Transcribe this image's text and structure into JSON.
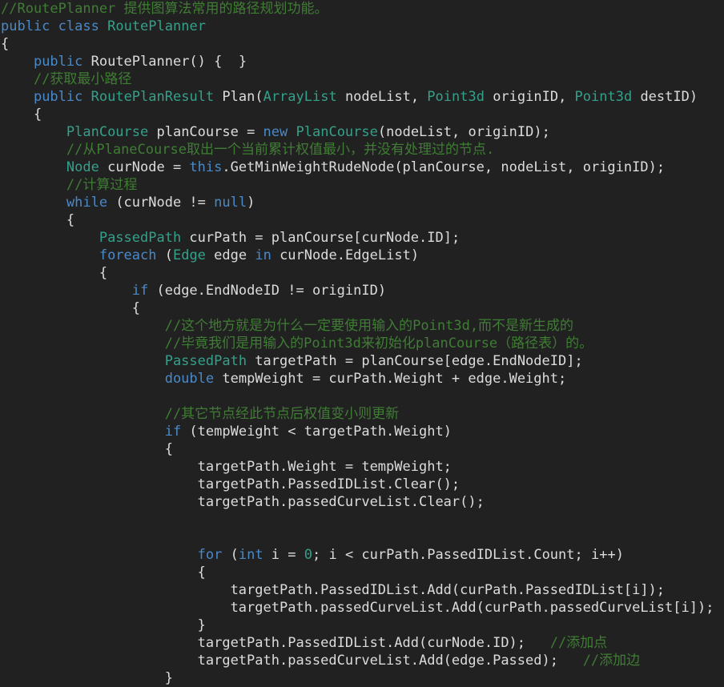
{
  "editor": {
    "language": "csharp",
    "file_title": "RoutePlanner.cs",
    "background_color": "#212121",
    "foreground_color": "#dcdcdc",
    "colors": {
      "keyword": "#4a89c8",
      "type": "#35a08a",
      "comment": "#3f7d34",
      "number": "#35a08a",
      "plain": "#dcdcdc"
    },
    "font_size_px": 17,
    "line_height_px": 22,
    "tab_size": 4
  },
  "code": {
    "lines": [
      {
        "n": 1,
        "tokens": [
          {
            "t": "comment",
            "v": "//RoutePlanner 提供图算法常用的路径规划功能。"
          }
        ]
      },
      {
        "n": 2,
        "tokens": [
          {
            "t": "kw",
            "v": "public"
          },
          {
            "t": "plain",
            "v": " "
          },
          {
            "t": "kw",
            "v": "class"
          },
          {
            "t": "plain",
            "v": " "
          },
          {
            "t": "type",
            "v": "RoutePlanner"
          }
        ]
      },
      {
        "n": 3,
        "tokens": [
          {
            "t": "plain",
            "v": "{"
          }
        ]
      },
      {
        "n": 4,
        "tokens": [
          {
            "t": "plain",
            "v": "    "
          },
          {
            "t": "kw",
            "v": "public"
          },
          {
            "t": "plain",
            "v": " RoutePlanner() {  }"
          }
        ]
      },
      {
        "n": 5,
        "tokens": [
          {
            "t": "plain",
            "v": "    "
          },
          {
            "t": "comment",
            "v": "//获取最小路径"
          }
        ]
      },
      {
        "n": 6,
        "tokens": [
          {
            "t": "plain",
            "v": "    "
          },
          {
            "t": "kw",
            "v": "public"
          },
          {
            "t": "plain",
            "v": " "
          },
          {
            "t": "type",
            "v": "RoutePlanResult"
          },
          {
            "t": "plain",
            "v": " Plan("
          },
          {
            "t": "type",
            "v": "ArrayList"
          },
          {
            "t": "plain",
            "v": " nodeList, "
          },
          {
            "t": "type",
            "v": "Point3d"
          },
          {
            "t": "plain",
            "v": " originID, "
          },
          {
            "t": "type",
            "v": "Point3d"
          },
          {
            "t": "plain",
            "v": " destID)"
          }
        ]
      },
      {
        "n": 7,
        "tokens": [
          {
            "t": "plain",
            "v": "    {"
          }
        ]
      },
      {
        "n": 8,
        "tokens": [
          {
            "t": "plain",
            "v": "        "
          },
          {
            "t": "type",
            "v": "PlanCourse"
          },
          {
            "t": "plain",
            "v": " planCourse = "
          },
          {
            "t": "kw",
            "v": "new"
          },
          {
            "t": "plain",
            "v": " "
          },
          {
            "t": "type",
            "v": "PlanCourse"
          },
          {
            "t": "plain",
            "v": "(nodeList, originID);"
          }
        ]
      },
      {
        "n": 9,
        "tokens": [
          {
            "t": "plain",
            "v": "        "
          },
          {
            "t": "comment",
            "v": "//从PlaneCourse取出一个当前累计权值最小，并没有处理过的节点."
          }
        ]
      },
      {
        "n": 10,
        "tokens": [
          {
            "t": "plain",
            "v": "        "
          },
          {
            "t": "type",
            "v": "Node"
          },
          {
            "t": "plain",
            "v": " curNode = "
          },
          {
            "t": "kw",
            "v": "this"
          },
          {
            "t": "plain",
            "v": ".GetMinWeightRudeNode(planCourse, nodeList, originID);"
          }
        ]
      },
      {
        "n": 11,
        "tokens": [
          {
            "t": "plain",
            "v": "        "
          },
          {
            "t": "comment",
            "v": "//计算过程"
          }
        ]
      },
      {
        "n": 12,
        "tokens": [
          {
            "t": "plain",
            "v": "        "
          },
          {
            "t": "kw",
            "v": "while"
          },
          {
            "t": "plain",
            "v": " (curNode != "
          },
          {
            "t": "kw",
            "v": "null"
          },
          {
            "t": "plain",
            "v": ")"
          }
        ]
      },
      {
        "n": 13,
        "tokens": [
          {
            "t": "plain",
            "v": "        {"
          }
        ]
      },
      {
        "n": 14,
        "tokens": [
          {
            "t": "plain",
            "v": "            "
          },
          {
            "t": "type",
            "v": "PassedPath"
          },
          {
            "t": "plain",
            "v": " curPath = planCourse[curNode.ID];"
          }
        ]
      },
      {
        "n": 15,
        "tokens": [
          {
            "t": "plain",
            "v": "            "
          },
          {
            "t": "kw",
            "v": "foreach"
          },
          {
            "t": "plain",
            "v": " ("
          },
          {
            "t": "type",
            "v": "Edge"
          },
          {
            "t": "plain",
            "v": " edge "
          },
          {
            "t": "kw",
            "v": "in"
          },
          {
            "t": "plain",
            "v": " curNode.EdgeList)"
          }
        ]
      },
      {
        "n": 16,
        "tokens": [
          {
            "t": "plain",
            "v": "            {"
          }
        ]
      },
      {
        "n": 17,
        "tokens": [
          {
            "t": "plain",
            "v": "                "
          },
          {
            "t": "kw",
            "v": "if"
          },
          {
            "t": "plain",
            "v": " (edge.EndNodeID != originID)"
          }
        ]
      },
      {
        "n": 18,
        "tokens": [
          {
            "t": "plain",
            "v": "                {"
          }
        ]
      },
      {
        "n": 19,
        "tokens": [
          {
            "t": "plain",
            "v": "                    "
          },
          {
            "t": "comment",
            "v": "//这个地方就是为什么一定要使用输入的Point3d,而不是新生成的"
          }
        ]
      },
      {
        "n": 20,
        "tokens": [
          {
            "t": "plain",
            "v": "                    "
          },
          {
            "t": "comment",
            "v": "//毕竟我们是用输入的Point3d来初始化planCourse（路径表）的。"
          }
        ]
      },
      {
        "n": 21,
        "tokens": [
          {
            "t": "plain",
            "v": "                    "
          },
          {
            "t": "type",
            "v": "PassedPath"
          },
          {
            "t": "plain",
            "v": " targetPath = planCourse[edge.EndNodeID];"
          }
        ]
      },
      {
        "n": 22,
        "tokens": [
          {
            "t": "plain",
            "v": "                    "
          },
          {
            "t": "kw",
            "v": "double"
          },
          {
            "t": "plain",
            "v": " tempWeight = curPath.Weight + edge.Weight;"
          }
        ]
      },
      {
        "n": 23,
        "tokens": []
      },
      {
        "n": 24,
        "tokens": [
          {
            "t": "plain",
            "v": "                    "
          },
          {
            "t": "comment",
            "v": "//其它节点经此节点后权值变小则更新"
          }
        ]
      },
      {
        "n": 25,
        "tokens": [
          {
            "t": "plain",
            "v": "                    "
          },
          {
            "t": "kw",
            "v": "if"
          },
          {
            "t": "plain",
            "v": " (tempWeight < targetPath.Weight)"
          }
        ]
      },
      {
        "n": 26,
        "tokens": [
          {
            "t": "plain",
            "v": "                    {"
          }
        ]
      },
      {
        "n": 27,
        "tokens": [
          {
            "t": "plain",
            "v": "                        targetPath.Weight = tempWeight;"
          }
        ]
      },
      {
        "n": 28,
        "tokens": [
          {
            "t": "plain",
            "v": "                        targetPath.PassedIDList.Clear();"
          }
        ]
      },
      {
        "n": 29,
        "tokens": [
          {
            "t": "plain",
            "v": "                        targetPath.passedCurveList.Clear();"
          }
        ]
      },
      {
        "n": 30,
        "tokens": []
      },
      {
        "n": 31,
        "tokens": []
      },
      {
        "n": 32,
        "tokens": [
          {
            "t": "plain",
            "v": "                        "
          },
          {
            "t": "kw",
            "v": "for"
          },
          {
            "t": "plain",
            "v": " ("
          },
          {
            "t": "kw",
            "v": "int"
          },
          {
            "t": "plain",
            "v": " i = "
          },
          {
            "t": "num",
            "v": "0"
          },
          {
            "t": "plain",
            "v": "; i < curPath.PassedIDList.Count; i++)"
          }
        ]
      },
      {
        "n": 33,
        "tokens": [
          {
            "t": "plain",
            "v": "                        {"
          }
        ]
      },
      {
        "n": 34,
        "tokens": [
          {
            "t": "plain",
            "v": "                            targetPath.PassedIDList.Add(curPath.PassedIDList[i]);"
          }
        ]
      },
      {
        "n": 35,
        "tokens": [
          {
            "t": "plain",
            "v": "                            targetPath.passedCurveList.Add(curPath.passedCurveList[i]);"
          }
        ]
      },
      {
        "n": 36,
        "tokens": [
          {
            "t": "plain",
            "v": "                        }"
          }
        ]
      },
      {
        "n": 37,
        "tokens": [
          {
            "t": "plain",
            "v": "                        targetPath.PassedIDList.Add(curNode.ID);   "
          },
          {
            "t": "comment",
            "v": "//添加点"
          }
        ]
      },
      {
        "n": 38,
        "tokens": [
          {
            "t": "plain",
            "v": "                        targetPath.passedCurveList.Add(edge.Passed);   "
          },
          {
            "t": "comment",
            "v": "//添加边"
          }
        ]
      },
      {
        "n": 39,
        "tokens": [
          {
            "t": "plain",
            "v": "                    }"
          }
        ]
      }
    ]
  }
}
